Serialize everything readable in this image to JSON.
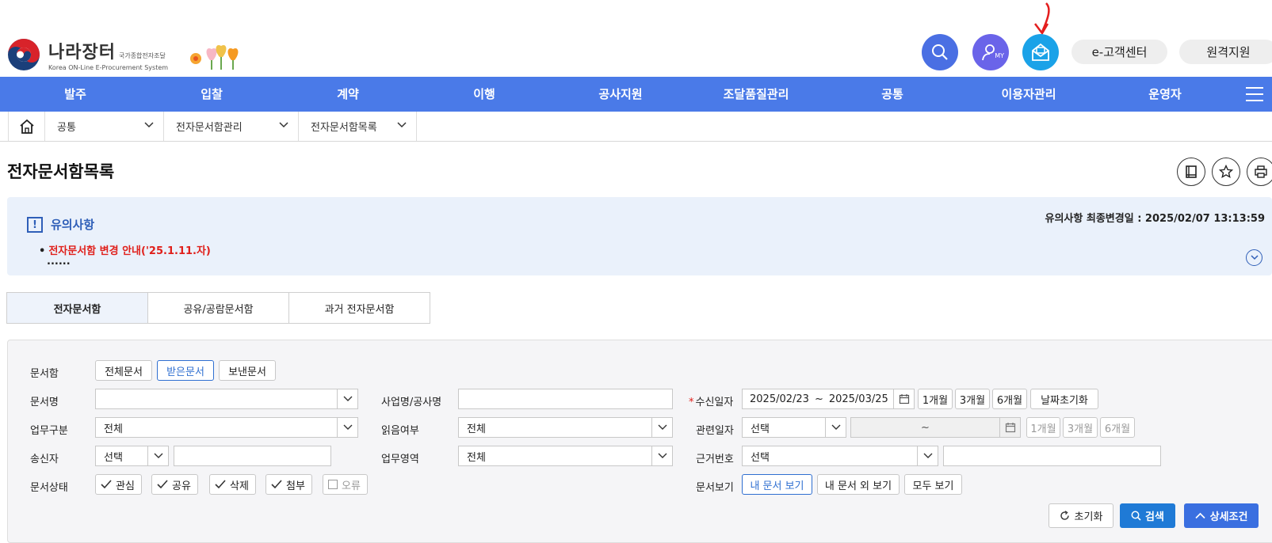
{
  "header": {
    "logo_main": "나라장터",
    "logo_sub_ko": "국가종합전자조달",
    "logo_en": "Korea ON-Line E-Procurement System",
    "my_label": "MY",
    "customer_center": "e-고객센터",
    "remote_support": "원격지원"
  },
  "nav": {
    "items": [
      "발주",
      "입찰",
      "계약",
      "이행",
      "공사지원",
      "조달품질관리",
      "공통",
      "이용자관리",
      "운영자"
    ]
  },
  "breadcrumb": {
    "items": [
      "공통",
      "전자문서함관리",
      "전자문서함목록"
    ]
  },
  "page": {
    "title": "전자문서함목록"
  },
  "notice": {
    "icon": "!",
    "title": "유의사항",
    "date_label": "유의사항 최종변경일 : 2025/02/07 13:13:59",
    "bullet_dot": "•",
    "item": "전자문서함 변경 안내('25.1.11.자)",
    "more": "......"
  },
  "tabs": [
    "전자문서함",
    "공유/공람문서함",
    "과거 전자문서함"
  ],
  "search": {
    "mailbox_label": "문서함",
    "mailbox_options": [
      "전체문서",
      "받은문서",
      "보낸문서"
    ],
    "doc_name_label": "문서명",
    "doc_name_value": "",
    "business_type_label": "업무구분",
    "business_type_value": "전체",
    "sender_label": "송신자",
    "sender_select": "선택",
    "sender_value": "",
    "doc_status_label": "문서상태",
    "doc_status_options": [
      {
        "label": "관심",
        "checked": true
      },
      {
        "label": "공유",
        "checked": true
      },
      {
        "label": "삭제",
        "checked": true
      },
      {
        "label": "첨부",
        "checked": true
      },
      {
        "label": "오류",
        "checked": false
      }
    ],
    "project_name_label": "사업명/공사명",
    "project_name_value": "",
    "read_status_label": "읽음여부",
    "read_status_value": "전체",
    "business_area_label": "업무영역",
    "business_area_value": "전체",
    "required_mark": "*",
    "receive_date_label": "수신일자",
    "receive_date_from": "2025/02/23",
    "date_sep": "~",
    "receive_date_to": "2025/03/25",
    "period_1m": "1개월",
    "period_3m": "3개월",
    "period_6m": "6개월",
    "date_reset": "날짜초기화",
    "related_date_label": "관련일자",
    "related_date_select": "선택",
    "related_date_sep": "~",
    "basis_no_label": "근거번호",
    "basis_no_select": "선택",
    "basis_no_value": "",
    "doc_view_label": "문서보기",
    "doc_view_options": [
      "내 문서 보기",
      "내 문서 외 보기",
      "모두 보기"
    ],
    "reset_button": "초기화",
    "search_button": "검색",
    "detail_button": "상세조건"
  },
  "colors": {
    "nav_bg": "#4a7ae8",
    "accent_blue": "#2f6fd1",
    "notice_bg": "#eaf1fb",
    "alert_red": "#e0201b",
    "search_btn": "#1f7ad6"
  }
}
